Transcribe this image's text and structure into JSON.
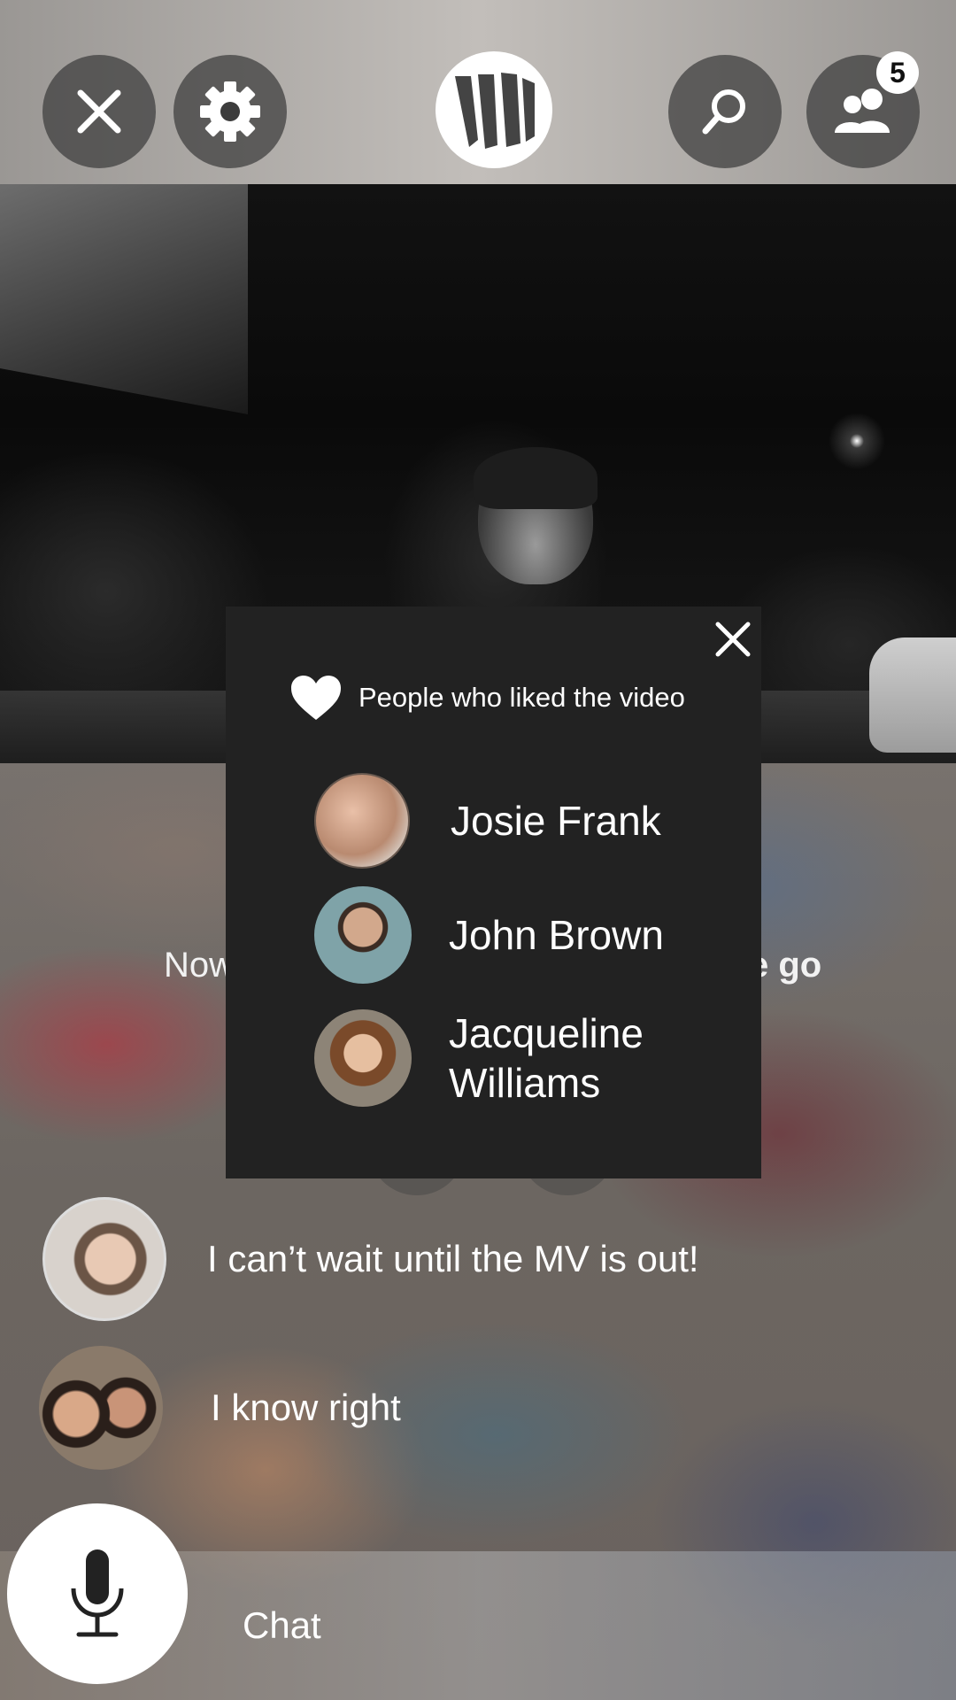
{
  "top_bar": {
    "friends_badge_count": "5"
  },
  "behind_overlay": {
    "partial_left_text": "Now",
    "partial_right_text": "e go"
  },
  "likes_popup": {
    "title": "People who liked the video",
    "likers": [
      {
        "name": "Josie Frank"
      },
      {
        "name": "John Brown"
      },
      {
        "name": "Jacqueline Williams"
      }
    ]
  },
  "chat": {
    "messages": [
      {
        "text": "I can’t wait until the MV is out!"
      },
      {
        "text": "I know right"
      }
    ],
    "input_label": "Chat"
  },
  "colors": {
    "popup_background": "#222222",
    "icon_button_background": "#3c3c3c",
    "badge_background": "#ffffff"
  }
}
